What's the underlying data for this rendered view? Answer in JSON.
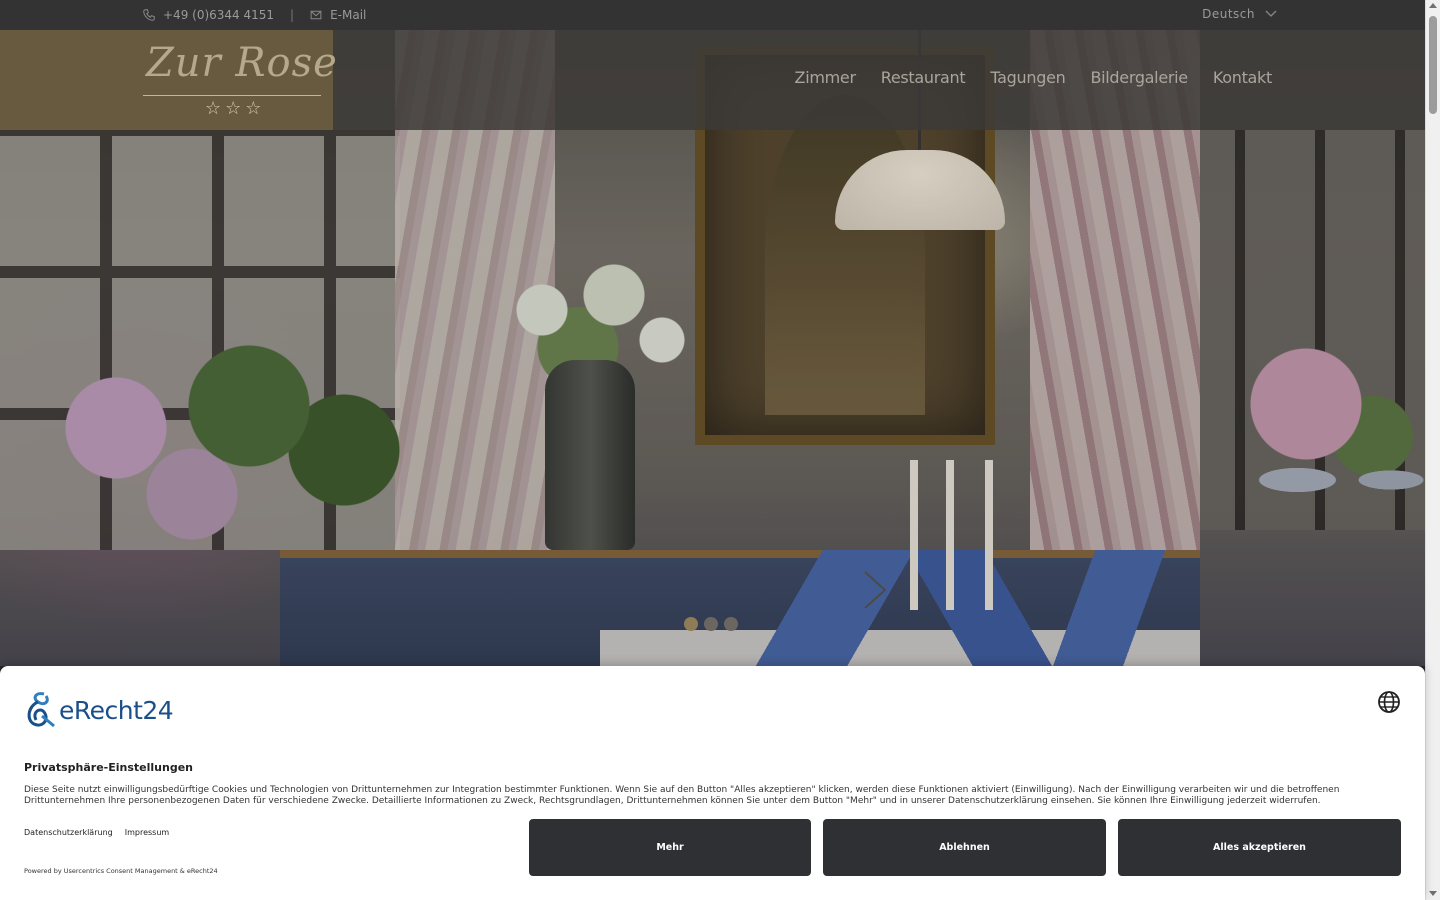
{
  "topbar": {
    "phone": "+49 (0)6344 4151",
    "email_label": "E-Mail",
    "language": "Deutsch",
    "icons": {
      "phone": "phone-icon",
      "email": "envelope-icon",
      "language": "chevron-down-icon"
    }
  },
  "header": {
    "logo_text": "Zur Rose",
    "stars": "☆☆☆",
    "nav": [
      "Zimmer",
      "Restaurant",
      "Tagungen",
      "Bildergalerie",
      "Kontakt"
    ]
  },
  "slider": {
    "dots": 3,
    "active_dot": 1
  },
  "consent": {
    "brand": "eRecht24",
    "title": "Privatsphäre-Einstellungen",
    "text": "Diese Seite nutzt einwilligungsbedürftige Cookies und Technologien von Drittunternehmen zur Integration bestimmter Funktionen. Wenn Sie auf den Button \"Alles akzeptieren\" klicken, werden diese Funktionen aktiviert (Einwilligung). Nach der Einwilligung verarbeiten wir und die betroffenen Drittunternehmen Ihre personenbezogenen Daten für verschiedene Zwecke. Detaillierte Informationen zu Zweck, Rechtsgrundlagen, Drittunternehmen können Sie unter dem Button \"Mehr\" und in unserer Datenschutzerklärung einsehen. Sie können Ihre Einwilligung jederzeit widerrufen.",
    "links": [
      "Datenschutzerklärung",
      "Impressum"
    ],
    "powered_by": "Powered by Usercentrics Consent Management & eRecht24",
    "buttons": {
      "more": "Mehr",
      "deny": "Ablehnen",
      "accept": "Alles akzeptieren"
    }
  },
  "colors": {
    "topbar_bg": "#333333",
    "logo_bg": "#6e5f41",
    "button_bg": "#2f3034",
    "brand_blue": "#1b4f8a"
  }
}
